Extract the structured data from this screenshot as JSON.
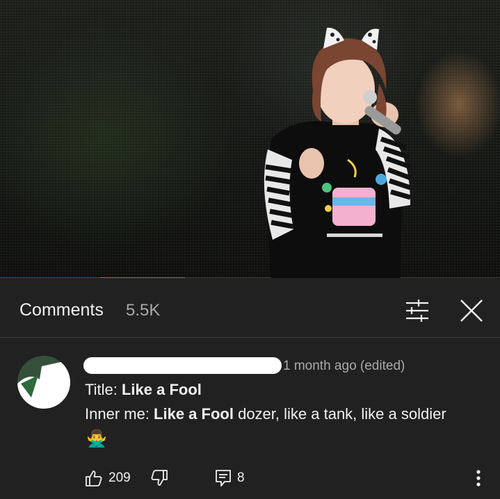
{
  "video": {
    "progress_played": 0.2,
    "progress_buffered": 0.37
  },
  "comments_header": {
    "title": "Comments",
    "count": "5.5K",
    "filter_icon": "sliders-icon",
    "close_icon": "close-icon"
  },
  "comment": {
    "author": "",
    "timestamp": "1 month ago (edited)",
    "line1_prefix": "Title: ",
    "line1_bold": "Like a Fool",
    "line2_prefix": "Inner me: ",
    "line2_bold": "Like a Fool",
    "line2_suffix": " dozer, like a tank, like a soldier",
    "emoji": "🙅‍♂️",
    "likes": "209",
    "replies": "8",
    "icons": {
      "like": "thumbs-up-icon",
      "dislike": "thumbs-down-icon",
      "reply": "reply-icon",
      "more": "more-vertical-icon"
    }
  },
  "colors": {
    "background": "#212121",
    "progress_played": "#e00000",
    "secondary_text": "#aaaaaa"
  }
}
